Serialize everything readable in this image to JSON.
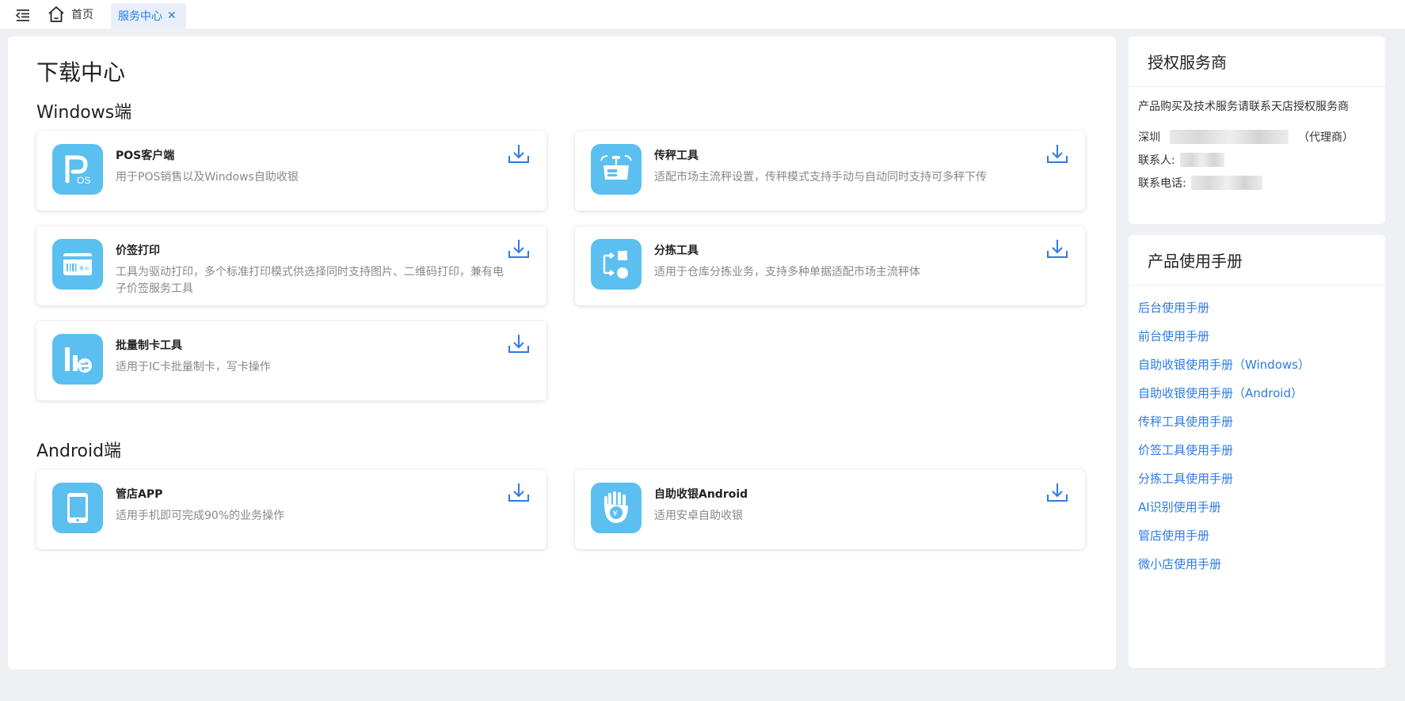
{
  "tabs": {
    "home_label": "首页",
    "active_label": "服务中心"
  },
  "colors": {
    "accent": "#2d7be0",
    "icon_bg": "#5bbff0"
  },
  "download_center": {
    "title": "下载中心",
    "windows_section": "Windows端",
    "android_section": "Android端",
    "windows_apps": [
      {
        "name": "POS客户端",
        "desc": "用于POS销售以及Windows自助收银",
        "icon": "pos-logo-icon"
      },
      {
        "name": "传秤工具",
        "desc": "适配市场主流秤设置，传秤模式支持手动与自动同时支持可多秤下传",
        "icon": "scale-icon"
      },
      {
        "name": "价签打印",
        "desc": "工具为驱动打印，多个标准打印模式供选择同时支持图片、二维码打印，兼有电子价签服务工具",
        "icon": "price-tag-icon"
      },
      {
        "name": "分拣工具",
        "desc": "适用于仓库分拣业务，支持多种单据适配市场主流秤体",
        "icon": "sorting-icon"
      },
      {
        "name": "批量制卡工具",
        "desc": "适用于IC卡批量制卡，写卡操作",
        "icon": "card-batch-icon"
      }
    ],
    "android_apps": [
      {
        "name": "管店APP",
        "desc": "适用手机即可完成90%的业务操作",
        "icon": "tablet-icon"
      },
      {
        "name": "自助收银Android",
        "desc": "适用安卓自助收银",
        "icon": "self-checkout-icon"
      }
    ]
  },
  "agent": {
    "title": "授权服务商",
    "intro": "产品购买及技术服务请联系天店授权服务商",
    "city_label": "深圳",
    "city_suffix": "（代理商）",
    "contact_label": "联系人:",
    "phone_label": "联系电话:"
  },
  "manuals": {
    "title": "产品使用手册",
    "links": [
      "后台使用手册",
      "前台使用手册",
      "自助收银使用手册（Windows）",
      "自助收银使用手册（Android）",
      "传秤工具使用手册",
      "价签工具使用手册",
      "分拣工具使用手册",
      "AI识别使用手册",
      "管店使用手册",
      "微小店使用手册"
    ]
  }
}
